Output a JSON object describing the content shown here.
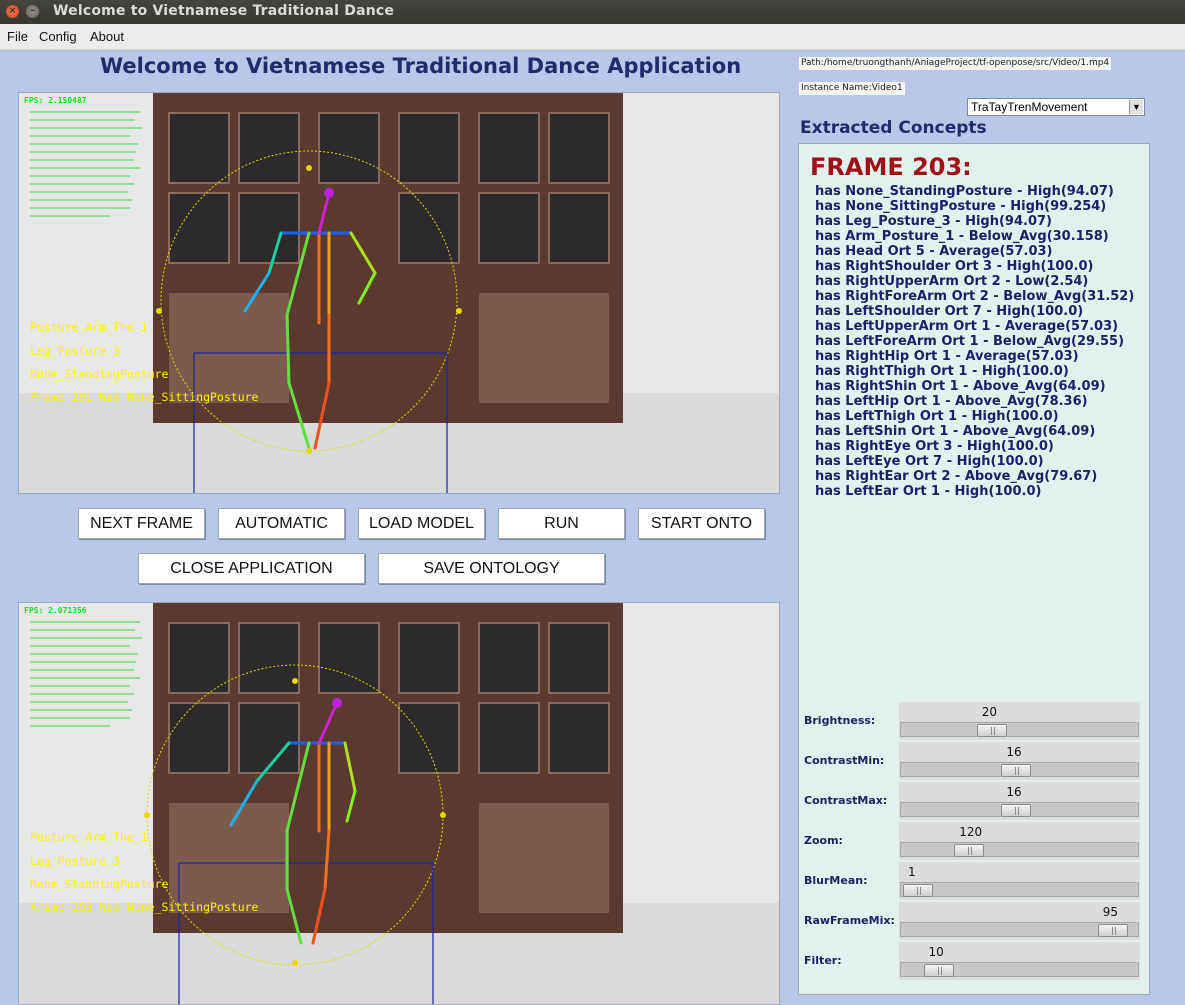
{
  "window": {
    "title": "Welcome to Vietnamese Traditional Dance",
    "close_glyph": "×",
    "min_glyph": "–"
  },
  "menu": [
    "File",
    "Config",
    "About"
  ],
  "heading": "Welcome to Vietnamese Traditional Dance Application",
  "videos": [
    {
      "fps": "FPS: 2.150487",
      "overlay": [
        "Posture_Arm_The_1",
        "Leg_Posture_3",
        "None_StandingPosture",
        "Frame 201 has None_SittingPosture"
      ]
    },
    {
      "fps": "FPS: 2.071356",
      "overlay": [
        "Posture_Arm_The_1",
        "Leg_Posture_3",
        "None_StandingPosture",
        "Frame 203 has None_SittingPosture"
      ]
    }
  ],
  "buttons": {
    "next_frame": "NEXT FRAME",
    "automatic": "AUTOMATIC",
    "load_model": "LOAD MODEL",
    "run": "RUN",
    "start_onto": "START ONTO",
    "close_application": "CLOSE APPLICATION",
    "save_ontology": "SAVE ONTOLOGY"
  },
  "path_label": "Path:/home/truongthanh/AniageProject/tf-openpose/src/Video/1.mp4",
  "instance_label": "Instance Name:Video1",
  "movement_select": "TraTayTrenMovement",
  "extracted_title": "Extracted Concepts",
  "frame_title": "FRAME 203:",
  "concepts": [
    "has None_StandingPosture - High(94.07)",
    "has None_SittingPosture - High(99.254)",
    "has Leg_Posture_3 - High(94.07)",
    "has Arm_Posture_1 - Below_Avg(30.158)",
    "has Head Ort 5 - Average(57.03)",
    "has RightShoulder Ort 3 - High(100.0)",
    "has RightUpperArm Ort 2 - Low(2.54)",
    "has RightForeArm Ort 2 - Below_Avg(31.52)",
    "has LeftShoulder Ort 7 - High(100.0)",
    "has LeftUpperArm Ort 1 - Average(57.03)",
    "has LeftForeArm Ort 1 - Below_Avg(29.55)",
    "has RightHip Ort 1 - Average(57.03)",
    "has RightThigh Ort 1 - High(100.0)",
    "has RightShin Ort 1 - Above_Avg(64.09)",
    "has LeftHip Ort 1 - Above_Avg(78.36)",
    "has LeftThigh Ort 1 - High(100.0)",
    "has LeftShin Ort 1 - Above_Avg(64.09)",
    "has RightEye Ort 3 - High(100.0)",
    "has LeftEye Ort 7 - High(100.0)",
    "has RightEar Ort 2 - Above_Avg(79.67)",
    "has LeftEar Ort 1 - High(100.0)"
  ],
  "sliders": [
    {
      "label": "Brightness:",
      "value": "20",
      "level": 0.36
    },
    {
      "label": "ContrastMin:",
      "value": "16",
      "level": 0.48
    },
    {
      "label": "ContrastMax:",
      "value": "16",
      "level": 0.48
    },
    {
      "label": "Zoom:",
      "value": "120",
      "level": 0.25
    },
    {
      "label": "BlurMean:",
      "value": "1",
      "level": 0.0
    },
    {
      "label": "RawFrameMix:",
      "value": "95",
      "level": 0.95
    },
    {
      "label": "Filter:",
      "value": "10",
      "level": 0.1
    }
  ]
}
